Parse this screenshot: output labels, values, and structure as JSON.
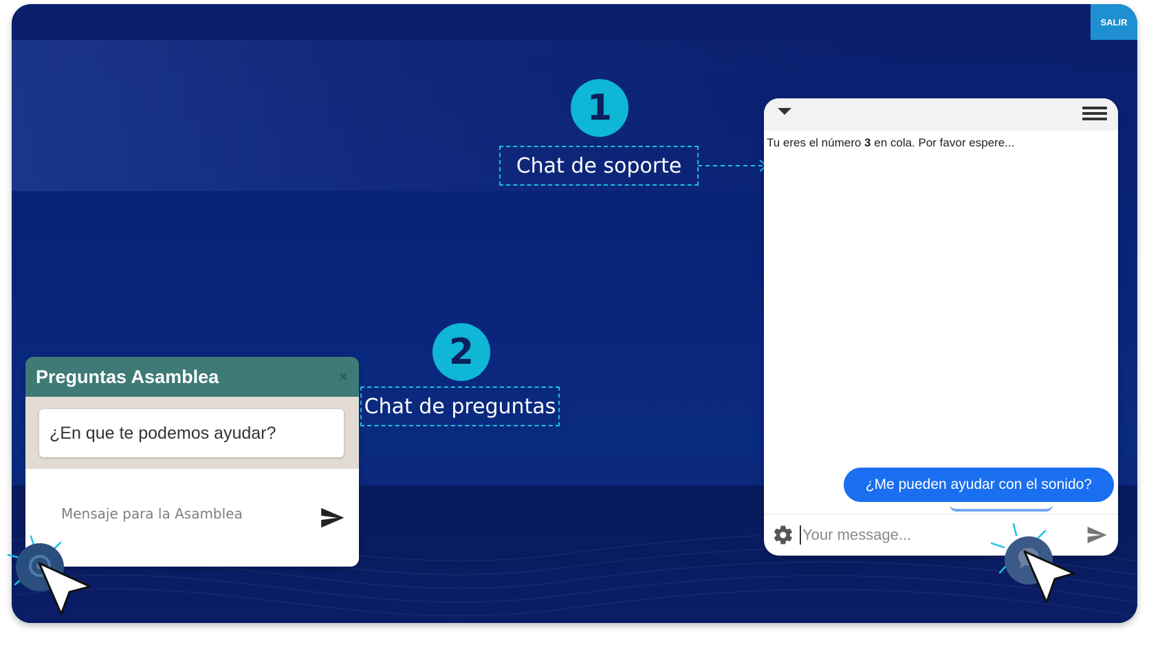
{
  "header": {
    "exit_label": "SALIR"
  },
  "callouts": [
    {
      "number": "1",
      "label": "Chat de soporte"
    },
    {
      "number": "2",
      "label": "Chat de preguntas"
    }
  ],
  "support_chat": {
    "queue_prefix": "Tu eres el número ",
    "queue_number": "3",
    "queue_suffix": " en cola. Por favor espere...",
    "user_message": "¿Me pueden ayudar con el sonido?",
    "input_placeholder": "Your message..."
  },
  "questions_chat": {
    "title": "Preguntas Asamblea",
    "close_symbol": "×",
    "prompt": "¿En que te podemos ayudar?",
    "input_placeholder": "Mensaje para la Asamblea"
  },
  "colors": {
    "background": "#0a2a80",
    "accent": "#0fb6d6",
    "exit_button": "#1e8fd0",
    "questions_header": "#3e7a76",
    "user_bubble": "#1a6ef0"
  },
  "icons": [
    "caret-down-icon",
    "hamburger-menu-icon",
    "gear-icon",
    "send-icon",
    "close-icon",
    "chat-launcher-icon",
    "mouse-pointer-icon"
  ]
}
